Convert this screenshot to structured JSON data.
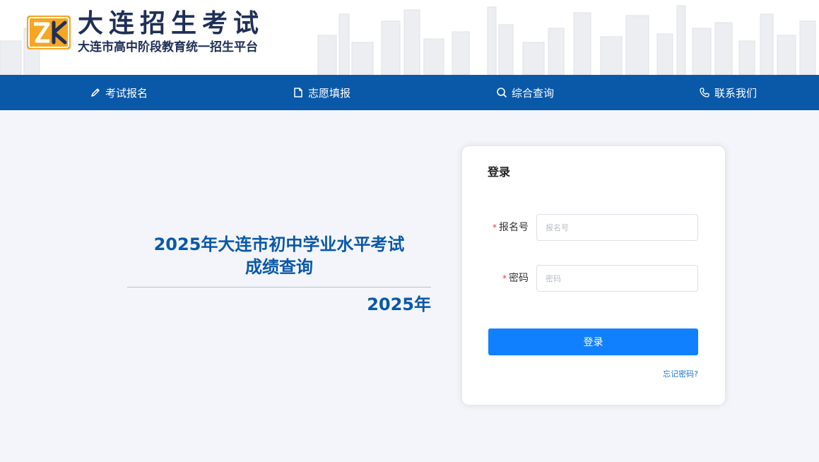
{
  "header": {
    "title": "大连招生考试",
    "subtitle": "大连市高中阶段教育统一招生平台",
    "logo_icon": "zk-logo-icon"
  },
  "nav": {
    "items": [
      {
        "label": "考试报名",
        "icon": "pencil-icon"
      },
      {
        "label": "志愿填报",
        "icon": "document-icon"
      },
      {
        "label": "综合查询",
        "icon": "search-icon"
      },
      {
        "label": "联系我们",
        "icon": "phone-icon"
      }
    ]
  },
  "hero": {
    "title_line1": "2025年大连市初中学业水平考试",
    "title_line2": "成绩查询",
    "year": "2025年"
  },
  "login": {
    "title": "登录",
    "required_mark": "*",
    "fields": {
      "reg_no": {
        "label": "报名号",
        "placeholder": "报名号",
        "value": ""
      },
      "password": {
        "label": "密码",
        "placeholder": "密码",
        "value": ""
      }
    },
    "submit_label": "登录",
    "forgot_label": "忘记密码?"
  },
  "colors": {
    "nav_bg": "#0a58a8",
    "hero_text": "#0a58a8",
    "button": "#1180ff",
    "link": "#1a73d9",
    "required": "#e0413d",
    "logo_orange": "#f5a623"
  }
}
